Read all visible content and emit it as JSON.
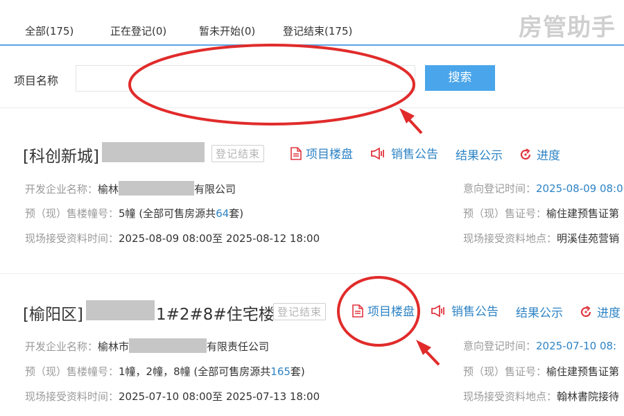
{
  "tabs": [
    {
      "label": "全部(175)"
    },
    {
      "label": "正在登记(0)"
    },
    {
      "label": "暂未开始(0)"
    },
    {
      "label": "登记结束(175)"
    }
  ],
  "watermark": "房管助手",
  "search": {
    "label": "项目名称",
    "placeholder": "",
    "button": "搜索"
  },
  "projects": [
    {
      "title_prefix": "[科创新城]",
      "title_suffix": "",
      "status": "登记结束",
      "actions": {
        "building": "项目楼盘",
        "notice": "销售公告",
        "result": "结果公示",
        "progress": "进度"
      },
      "developer_label": "开发企业名称：",
      "developer_prefix": "榆林",
      "developer_suffix": "有限公司",
      "buildings_label": "预（现）售楼幢号：",
      "buildings_value": "5幢 (全部可售房源共",
      "buildings_count": "64",
      "buildings_unit": "套)",
      "docs_time_label": "现场接受资料时间：",
      "docs_time_value": "2025-08-09 08:00至 2025-08-12 18:00",
      "reg_time_label": "意向登记时间：",
      "reg_time_value": "2025-08-09 08:0",
      "permit_label": "预（现）售证号：",
      "permit_value": "榆住建预售证第",
      "docs_place_label": "现场接受资料地点：",
      "docs_place_value": "明溪佳苑营销"
    },
    {
      "title_prefix": "[榆阳区]",
      "title_suffix": "1#2#8#住宅楼",
      "status": "登记结束",
      "actions": {
        "building": "项目楼盘",
        "notice": "销售公告",
        "result": "结果公示",
        "progress": "进度"
      },
      "developer_label": "开发企业名称：",
      "developer_prefix": "榆林市",
      "developer_suffix": "有限责任公司",
      "buildings_label": "预（现）售楼幢号：",
      "buildings_value": "1幢，2幢，8幢 (全部可售房源共",
      "buildings_count": "165",
      "buildings_unit": "套)",
      "docs_time_label": "现场接受资料时间：",
      "docs_time_value": "2025-07-10 08:00至 2025-07-13 18:00",
      "reg_time_label": "意向登记时间：",
      "reg_time_value": "2025-07-10 08:",
      "permit_label": "预（现）售证号：",
      "permit_value": "榆住建预售证第",
      "docs_place_label": "现场接受资料地点：",
      "docs_place_value": "翰林書院接待"
    }
  ],
  "colors": {
    "accent": "#4aa5ea",
    "link": "#2d83c5",
    "icon_red": "#e0353e",
    "annotation": "#e12b2b"
  }
}
